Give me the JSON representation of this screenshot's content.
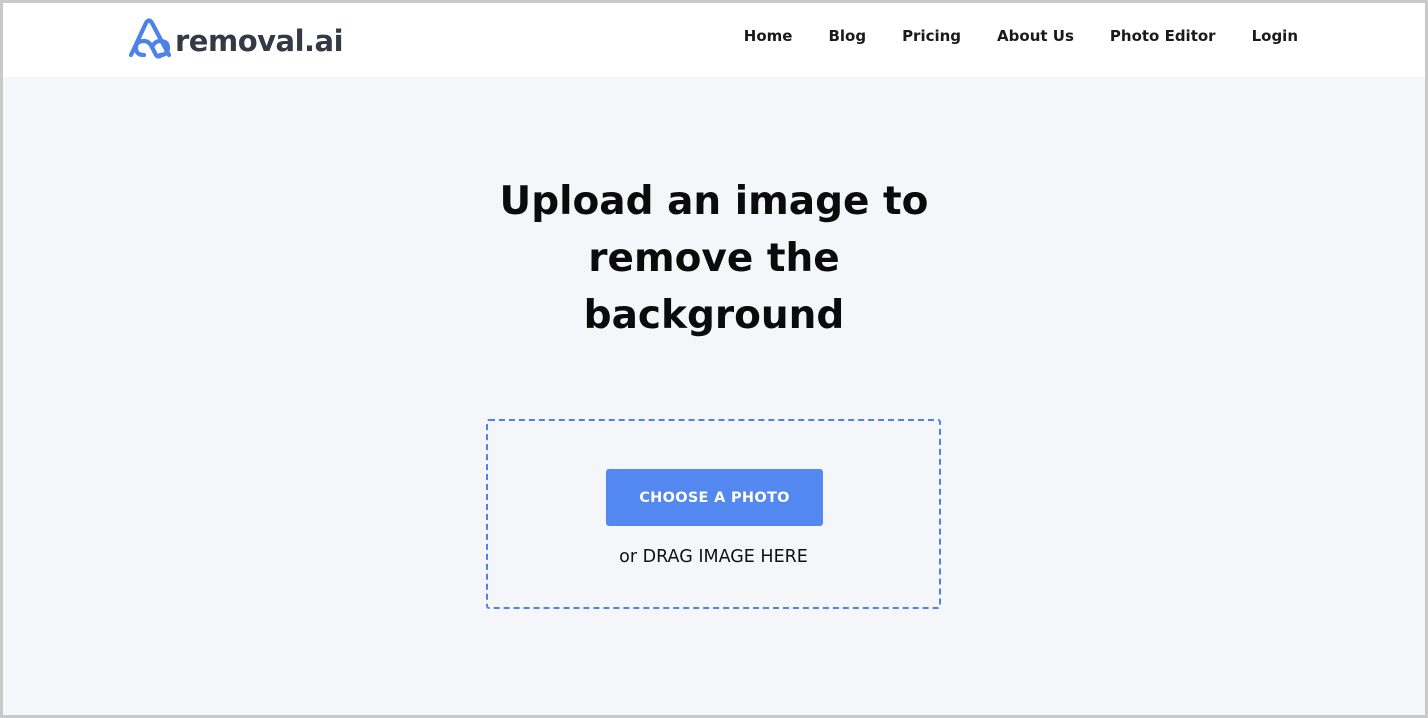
{
  "brand": {
    "name": "removal.ai",
    "logo_icon": "removal-ai-logo-icon",
    "logo_color": "#4d82e8",
    "text_color": "#333a45"
  },
  "nav": {
    "items": [
      {
        "label": "Home"
      },
      {
        "label": "Blog"
      },
      {
        "label": "Pricing"
      },
      {
        "label": "About Us"
      },
      {
        "label": "Photo Editor"
      },
      {
        "label": "Login"
      }
    ]
  },
  "hero": {
    "title_lines": [
      "Upload an image to",
      "remove the",
      "background"
    ]
  },
  "upload": {
    "button_label": "CHOOSE A PHOTO",
    "drag_hint": "or DRAG IMAGE HERE",
    "accent_color": "#5288ef",
    "border_color": "#4d82e8"
  },
  "colors": {
    "page_background": "#f5f6f9",
    "header_background": "#ffffff"
  }
}
